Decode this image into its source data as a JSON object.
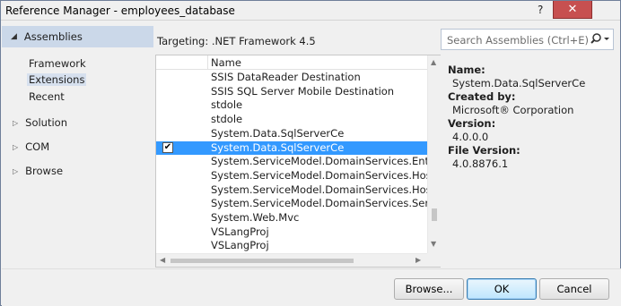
{
  "window": {
    "title": "Reference Manager - employees_database",
    "help": "?",
    "close": "✕"
  },
  "nav": {
    "header": "Assemblies",
    "sub_items": [
      "Framework",
      "Extensions",
      "Recent"
    ],
    "selected_sub": "Extensions",
    "groups": [
      "Solution",
      "COM",
      "Browse"
    ]
  },
  "center": {
    "targeting": "Targeting: .NET Framework 4.5",
    "column_name": "Name",
    "rows": [
      {
        "name": "SSIS DataReader Destination",
        "checked": false,
        "selected": false
      },
      {
        "name": "SSIS SQL Server Mobile Destination",
        "checked": false,
        "selected": false
      },
      {
        "name": "stdole",
        "checked": false,
        "selected": false
      },
      {
        "name": "stdole",
        "checked": false,
        "selected": false
      },
      {
        "name": "System.Data.SqlServerCe",
        "checked": false,
        "selected": false
      },
      {
        "name": "System.Data.SqlServerCe",
        "checked": true,
        "selected": true
      },
      {
        "name": "System.ServiceModel.DomainServices.EntityFramework",
        "checked": false,
        "selected": false
      },
      {
        "name": "System.ServiceModel.DomainServices.Hosting",
        "checked": false,
        "selected": false
      },
      {
        "name": "System.ServiceModel.DomainServices.Hosting.OData",
        "checked": false,
        "selected": false
      },
      {
        "name": "System.ServiceModel.DomainServices.Server",
        "checked": false,
        "selected": false
      },
      {
        "name": "System.Web.Mvc",
        "checked": false,
        "selected": false
      },
      {
        "name": "VSLangProj",
        "checked": false,
        "selected": false
      },
      {
        "name": "VSLangProj",
        "checked": false,
        "selected": false
      }
    ]
  },
  "search": {
    "placeholder": "Search Assemblies (Ctrl+E)"
  },
  "details": {
    "name_label": "Name:",
    "name_value": "System.Data.SqlServerCe",
    "created_label": "Created by:",
    "created_value": "Microsoft® Corporation",
    "version_label": "Version:",
    "version_value": "4.0.0.0",
    "file_version_label": "File Version:",
    "file_version_value": "4.0.8876.1"
  },
  "buttons": {
    "browse": "Browse...",
    "ok": "OK",
    "cancel": "Cancel"
  },
  "colors": {
    "selection": "#3399ff",
    "nav_header": "#cbd8e9",
    "close_button": "#c75050"
  }
}
